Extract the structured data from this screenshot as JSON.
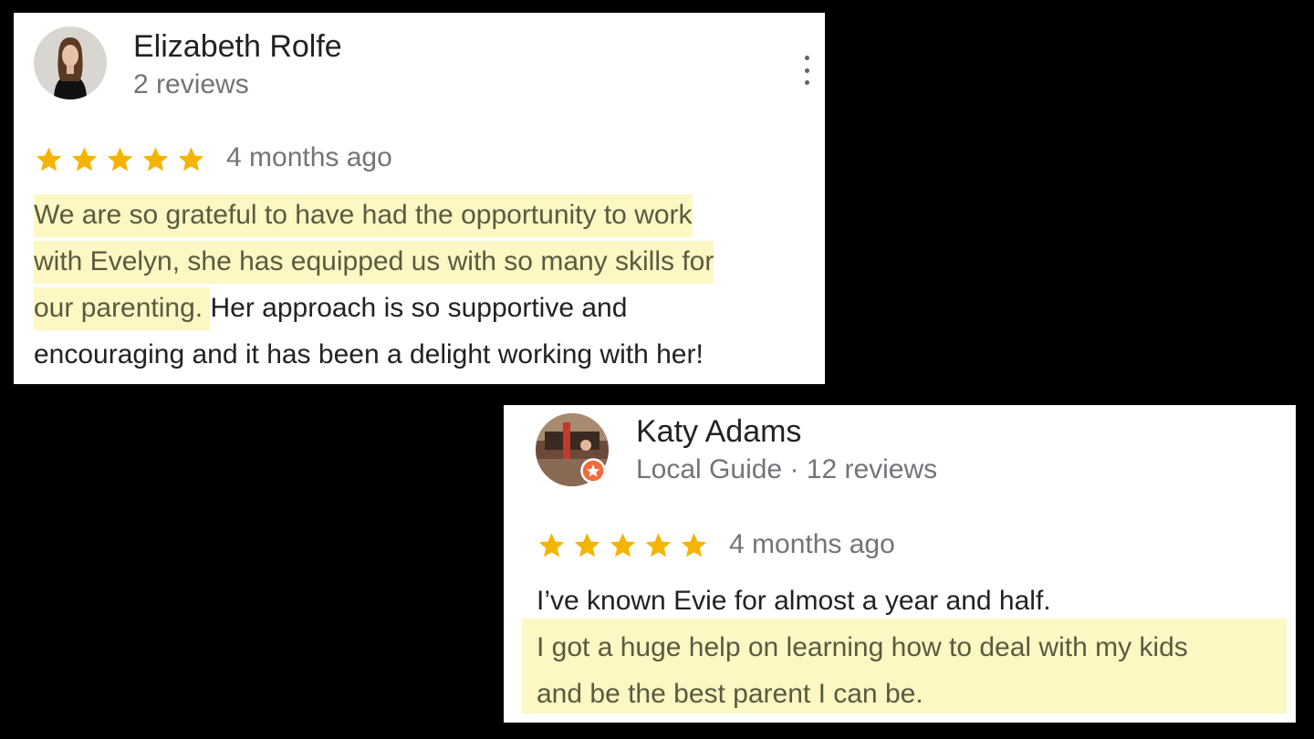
{
  "reviews": [
    {
      "author": "Elizabeth Rolfe",
      "meta": "2 reviews",
      "rating": 5,
      "time": "4 months ago",
      "lines": [
        {
          "hl": "We are so grateful to have had the opportunity to work",
          "rest": ""
        },
        {
          "hl": "with Evelyn, she has equipped us with so many skills for",
          "rest": ""
        },
        {
          "hl": "our parenting. ",
          "rest": "Her approach is so supportive and"
        },
        {
          "hl": "",
          "rest": "encouraging and it has been a delight working with her!"
        }
      ]
    },
    {
      "author": "Katy Adams",
      "meta": "Local Guide · 12 reviews",
      "rating": 5,
      "time": "4 months ago",
      "lines": [
        {
          "hl": "",
          "rest": "I’ve known Evie for almost a year and half."
        },
        {
          "hl": "I got a huge help on learning how to deal with my kids",
          "rest": ""
        },
        {
          "hl": "and be the best parent I can be.",
          "rest": ""
        }
      ]
    }
  ],
  "colors": {
    "star": "#f4b400",
    "highlight": "#fdf7c3",
    "text": "#222222",
    "muted": "#70757a",
    "background": "#000000"
  },
  "icons": [
    "avatar-photo",
    "local-guide-badge-icon",
    "star-icon",
    "more-vert-icon"
  ]
}
